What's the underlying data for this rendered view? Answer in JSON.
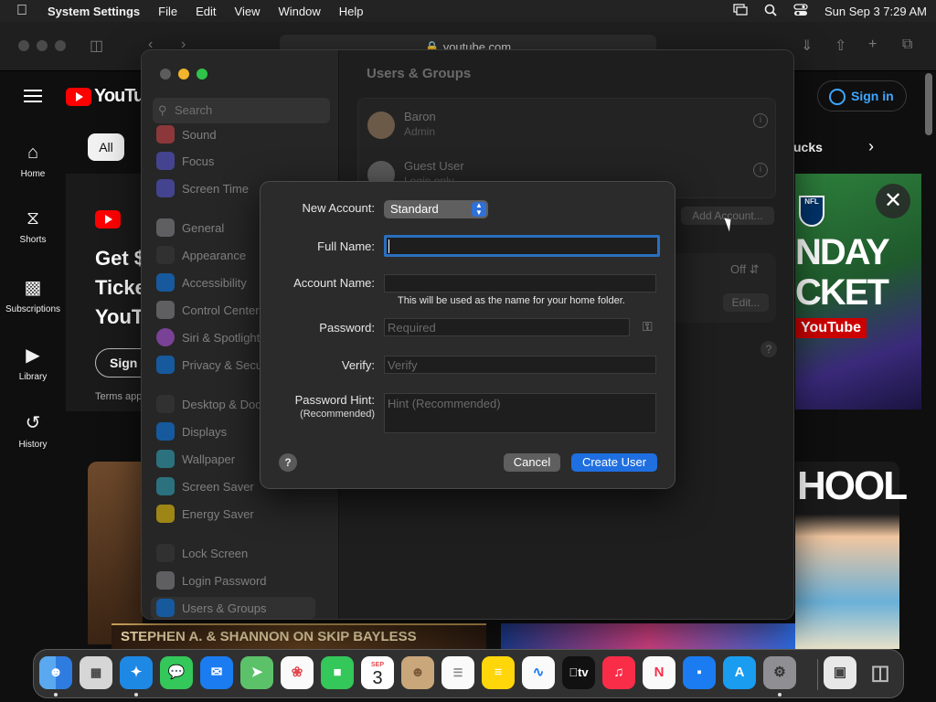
{
  "menubar": {
    "app_name": "System Settings",
    "menus": [
      "File",
      "Edit",
      "View",
      "Window",
      "Help"
    ],
    "datetime": "Sun Sep 3  7:29 AM"
  },
  "safari": {
    "url": "youtube.com"
  },
  "youtube": {
    "logo_text": "YouTube",
    "nav": [
      {
        "label": "Home",
        "icon": "home-icon"
      },
      {
        "label": "Shorts",
        "icon": "shorts-icon"
      },
      {
        "label": "Subscriptions",
        "icon": "subscriptions-icon"
      },
      {
        "label": "Library",
        "icon": "library-icon"
      },
      {
        "label": "History",
        "icon": "history-icon"
      }
    ],
    "chip_all": "All",
    "chip_partial": "ucks",
    "promo_lines": [
      "Get $",
      "Ticke",
      "YouT"
    ],
    "promo_button": "Sign u",
    "terms": "Terms app",
    "sign_in": "Sign in",
    "ad_text": "NDAY\nCKET",
    "ad_brand": "YouTube",
    "school_text": "HOOL",
    "thumb_caption": "STEPHEN A. & SHANNON ON SKIP BAYLESS"
  },
  "settings": {
    "search_placeholder": "Search",
    "sidebar": [
      {
        "label": "Sound",
        "color": "#e0484d"
      },
      {
        "label": "Focus",
        "color": "#5e5ce6"
      },
      {
        "label": "Screen Time",
        "color": "#5e5ce6"
      },
      {
        "label": "General",
        "color": "#8e8e93"
      },
      {
        "label": "Appearance",
        "color": "#2c2c2e"
      },
      {
        "label": "Accessibility",
        "color": "#0a84ff"
      },
      {
        "label": "Control Center",
        "color": "#8e8e93"
      },
      {
        "label": "Siri & Spotlight",
        "color": "#bf5af2"
      },
      {
        "label": "Privacy & Security",
        "color": "#0a84ff"
      },
      {
        "label": "Desktop & Dock",
        "color": "#2c2c2e"
      },
      {
        "label": "Displays",
        "color": "#0a84ff"
      },
      {
        "label": "Wallpaper",
        "color": "#30b0c7"
      },
      {
        "label": "Screen Saver",
        "color": "#30b0c7"
      },
      {
        "label": "Energy Saver",
        "color": "#ffd60a"
      },
      {
        "label": "Lock Screen",
        "color": "#2c2c2e"
      },
      {
        "label": "Login Password",
        "color": "#8e8e93"
      },
      {
        "label": "Users & Groups",
        "color": "#0a84ff"
      }
    ],
    "title": "Users & Groups",
    "users": [
      {
        "name": "Baron",
        "role": "Admin"
      },
      {
        "name": "Guest User",
        "role": "Login only"
      }
    ],
    "add_account": "Add Account...",
    "auto_login_value": "Off",
    "edit_label": "Edit..."
  },
  "dialog": {
    "new_account_label": "New Account:",
    "account_type": "Standard",
    "full_name_label": "Full Name:",
    "full_name_value": "",
    "account_name_label": "Account Name:",
    "account_name_value": "",
    "folder_note": "This will be used as the name for your home folder.",
    "password_label": "Password:",
    "password_placeholder": "Required",
    "verify_label": "Verify:",
    "verify_placeholder": "Verify",
    "hint_label": "Password Hint:",
    "hint_sub": "(Recommended)",
    "hint_placeholder": "Hint (Recommended)",
    "help": "?",
    "cancel": "Cancel",
    "create": "Create User"
  },
  "dock": {
    "calendar_month": "SEP",
    "calendar_day": "3",
    "tv_label": "tv",
    "apps": [
      "finder-icon",
      "launchpad-icon",
      "safari-icon",
      "messages-icon",
      "mail-icon",
      "maps-icon",
      "photos-icon",
      "facetime-icon",
      "calendar-icon",
      "contacts-icon",
      "reminders-icon",
      "notes-icon",
      "freeform-icon",
      "appletv-icon",
      "music-icon",
      "news-icon",
      "keynote-icon",
      "appstore-icon",
      "systemsettings-icon",
      "preview-icon",
      "trash-icon"
    ]
  }
}
